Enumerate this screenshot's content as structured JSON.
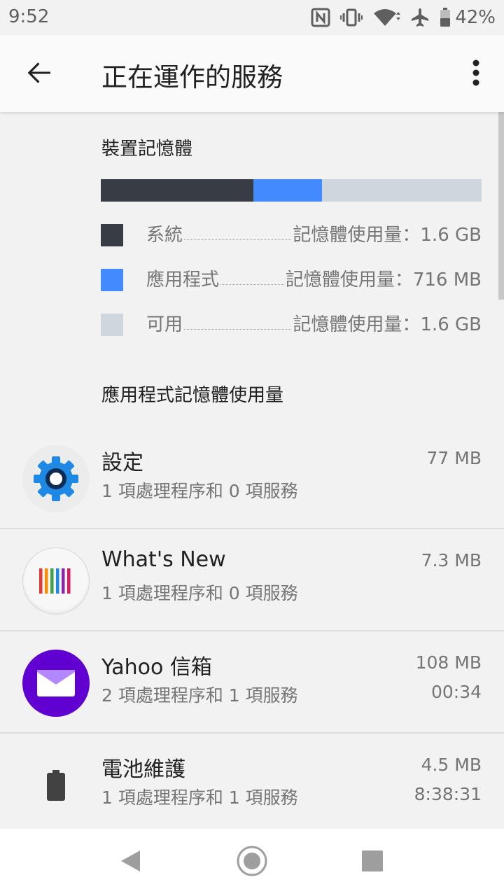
{
  "status_bar": {
    "time": "9:52",
    "battery_percent": "42%",
    "icons": [
      "nfc-icon",
      "vibrate-icon",
      "wifi-icon",
      "airplane-icon",
      "battery-icon"
    ]
  },
  "app_bar": {
    "title": "正在運作的服務",
    "back_icon": "arrow-left-icon",
    "more_icon": "more-vert-icon"
  },
  "device_memory": {
    "title": "裝置記憶體",
    "bar": {
      "system_fraction": 0.4,
      "apps_fraction": 0.18,
      "free_fraction": 0.42
    },
    "legend": [
      {
        "label": "系統",
        "value": "記憶體使用量：1.6 GB",
        "color": "#373c45"
      },
      {
        "label": "應用程式",
        "value": "記憶體使用量：716 MB",
        "color": "#448aff"
      },
      {
        "label": "可用",
        "value": "記憶體使用量：1.6 GB",
        "color": "#cfd6dd"
      }
    ]
  },
  "app_memory": {
    "title": "應用程式記憶體使用量",
    "apps": [
      {
        "name": "設定",
        "desc": "1 項處理程序和 0 項服務",
        "size": "77 MB",
        "time": "",
        "icon": "settings-gear-icon"
      },
      {
        "name": "What's New",
        "desc": "1 項處理程序和 0 項服務",
        "size": "7.3 MB",
        "time": "",
        "icon": "whats-new-icon"
      },
      {
        "name": "Yahoo 信箱",
        "desc": "2 項處理程序和 1 項服務",
        "size": "108 MB",
        "time": "00:34",
        "icon": "yahoo-mail-icon"
      },
      {
        "name": "電池維護",
        "desc": "1 項處理程序和 1 項服務",
        "size": "4.5 MB",
        "time": "8:38:31",
        "icon": "battery-care-icon"
      }
    ]
  },
  "nav_bar": {
    "buttons": [
      "back-triangle-icon",
      "home-circle-icon",
      "recents-square-icon"
    ]
  },
  "colors": {
    "accent": "#448aff",
    "system": "#373c45",
    "free": "#cfd6dd",
    "yahoo": "#6001d2"
  }
}
